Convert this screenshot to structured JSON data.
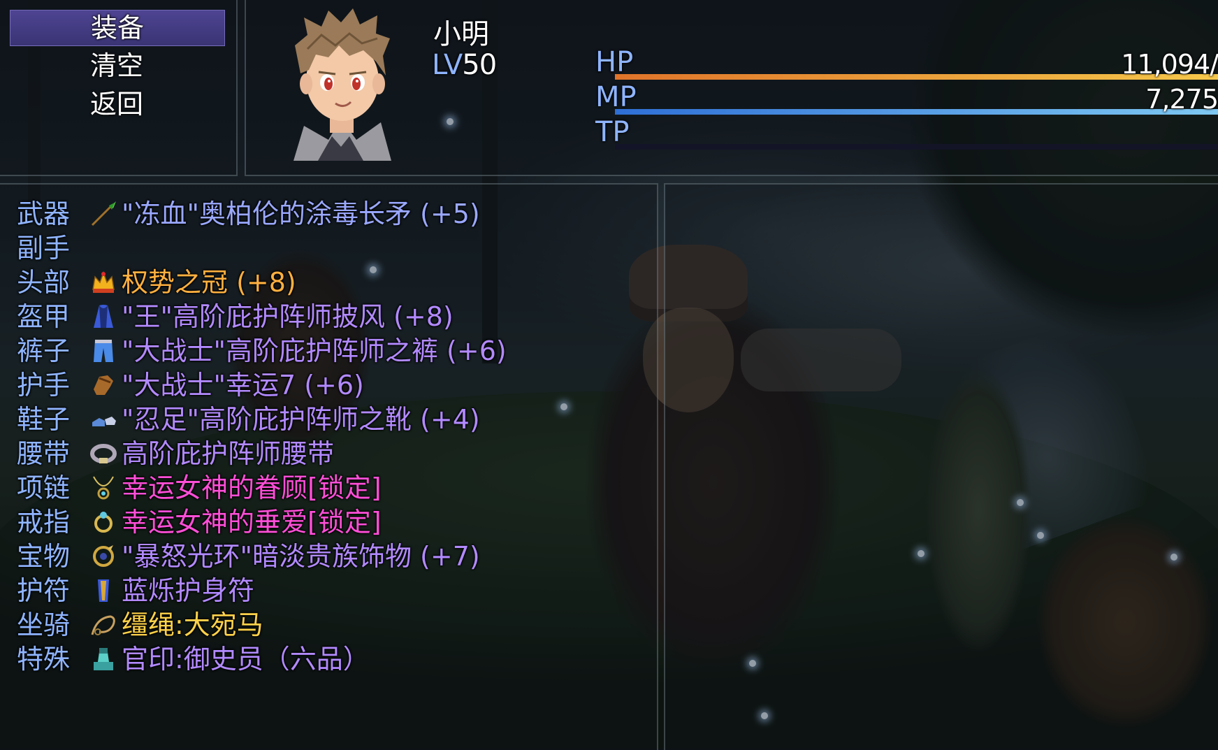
{
  "commands": [
    {
      "label": "装备",
      "selected": true
    },
    {
      "label": "清空",
      "selected": false
    },
    {
      "label": "返回",
      "selected": false
    }
  ],
  "actor": {
    "name": "小明",
    "level_label": "LV",
    "level": "50",
    "gauges": [
      {
        "label": "HP",
        "value": "11,094/",
        "fill": 1.0,
        "color_from": "#e0742a",
        "color_to": "#f5c84a"
      },
      {
        "label": "MP",
        "value": "7,275",
        "fill": 1.0,
        "color_from": "#2e6fd6",
        "color_to": "#7ec8f2"
      },
      {
        "label": "TP",
        "value": "",
        "fill": 0.0,
        "color_from": "#4a3a9a",
        "color_to": "#8a6ad8"
      }
    ]
  },
  "colors": {
    "slot_name": "#8fb4ff",
    "selected_command": "#4e4492"
  },
  "slots": [
    {
      "slot": "武器",
      "icon": "spear-icon",
      "item": "\"冻血\"奥柏伦的涂毒长矛 (+5)",
      "color": "c-blue"
    },
    {
      "slot": "副手",
      "icon": "",
      "item": "",
      "color": "c-white"
    },
    {
      "slot": "头部",
      "icon": "crown-icon",
      "item": "权势之冠 (+8)",
      "color": "c-orange"
    },
    {
      "slot": "盔甲",
      "icon": "cloak-icon",
      "item": "\"王\"高阶庇护阵师披风 (+8)",
      "color": "c-purple"
    },
    {
      "slot": "裤子",
      "icon": "pants-icon",
      "item": "\"大战士\"高阶庇护阵师之裤 (+6)",
      "color": "c-purple"
    },
    {
      "slot": "护手",
      "icon": "gauntlet-icon",
      "item": "\"大战士\"幸运7 (+6)",
      "color": "c-purple"
    },
    {
      "slot": "鞋子",
      "icon": "boots-icon",
      "item": "\"忍足\"高阶庇护阵师之靴 (+4)",
      "color": "c-purple"
    },
    {
      "slot": "腰带",
      "icon": "belt-icon",
      "item": "高阶庇护阵师腰带",
      "color": "c-purple"
    },
    {
      "slot": "项链",
      "icon": "necklace-icon",
      "item": "幸运女神的眷顾[锁定]",
      "color": "c-pink"
    },
    {
      "slot": "戒指",
      "icon": "ring-icon",
      "item": "幸运女神的垂爱[锁定]",
      "color": "c-pink"
    },
    {
      "slot": "宝物",
      "icon": "treasure-icon",
      "item": "\"暴怒光环\"暗淡贵族饰物 (+7)",
      "color": "c-purple"
    },
    {
      "slot": "护符",
      "icon": "amulet-icon",
      "item": "蓝烁护身符",
      "color": "c-purple"
    },
    {
      "slot": "坐骑",
      "icon": "reins-icon",
      "item": "缰绳:大宛马",
      "color": "c-yellow"
    },
    {
      "slot": "特殊",
      "icon": "seal-icon",
      "item": "官印:御史员（六品）",
      "color": "c-purple"
    }
  ]
}
